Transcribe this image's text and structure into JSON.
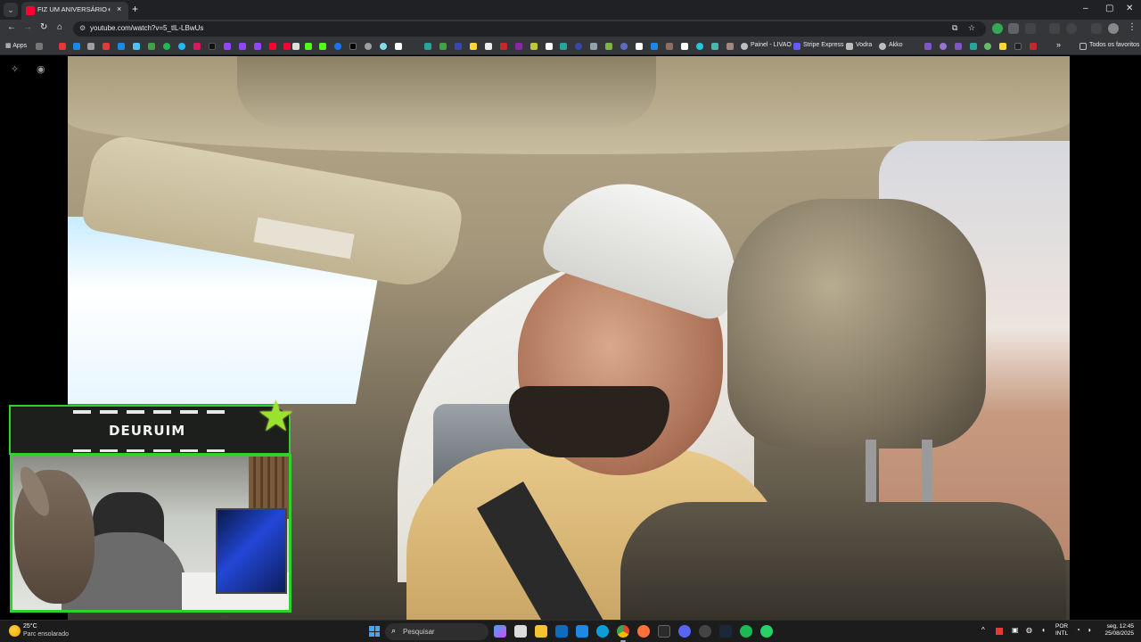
{
  "browser": {
    "tab": {
      "title": "FIZ UM ANIVERSÁRIO PRO",
      "audio_icon": "speaker-icon",
      "close_label": "×",
      "favicon_color": "#ff0033"
    },
    "new_tab_label": "+",
    "tab_menu_label": "⌄",
    "window_controls": {
      "minimize": "–",
      "maximize": "▢",
      "close": "✕"
    },
    "nav": {
      "back": "←",
      "forward": "→",
      "reload": "↻",
      "home": "⌂"
    },
    "url": "youtube.com/watch?v=5_tlL-LBwUs",
    "omnibox_actions": {
      "install": "⧉",
      "bookmark": "☆"
    },
    "more_label": "⋮"
  },
  "bookmarks": {
    "apps_label": "Apps",
    "painel_label": "Painel - LIVAO",
    "stripe_label": "Stripe Express",
    "vodra_label": "Vodra",
    "akko_label": "Akko",
    "overflow_label": "»",
    "all_favorites_label": "Todos os favoritos"
  },
  "video_tools": {
    "magic": "✧",
    "camera": "◉"
  },
  "overlay": {
    "streamer_name": "DEURUIM",
    "accent_color": "#2fd12a",
    "star_icon": "★"
  },
  "taskbar": {
    "weather_temp": "25°C",
    "weather_desc": "Parc ensolarado",
    "search_placeholder": "Pesquisar",
    "search_icon": "⌕",
    "tray_up": "^",
    "language_line1": "POR",
    "language_line2": "INTL",
    "time": "seg, 12:45",
    "date": "25/08/2025"
  }
}
